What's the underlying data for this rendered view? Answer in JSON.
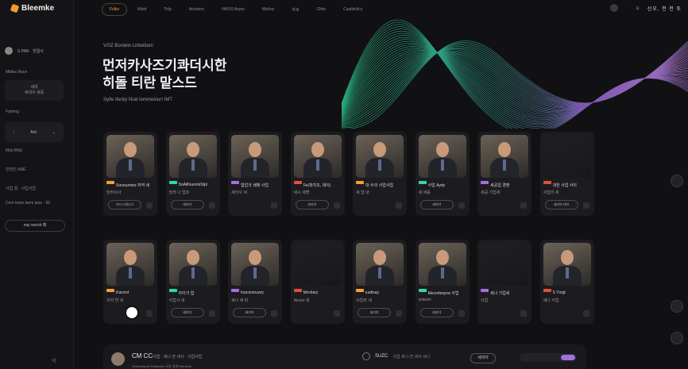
{
  "sidebar": {
    "logo": "Bleemke",
    "user": "S PAR · 연결사",
    "section1": "Mititas Bace",
    "card_line1": "세대",
    "card_line2": "세대사 세중",
    "section2": "Fairring",
    "select_left": "↑",
    "select_mid": "Ant",
    "select_right": "⌄",
    "item1": "Mob BNd",
    "item2": "안양인 ANE",
    "item3": "사업 월 · 사업사업",
    "item4": "Cent team lanm jane · 60",
    "pill": "nay wersb 패",
    "foot": "약"
  },
  "nav": {
    "tabs": [
      "Folks",
      "Weid",
      "Tirlp",
      "Aviokers",
      "VAIOS Aryes",
      "Mishss",
      "약세",
      "Clthe",
      "Castitictics"
    ],
    "active_index": 0
  },
  "topright": {
    "brand": "신오, 전 전 또",
    "items": [
      "·",
      "오"
    ]
  },
  "hero": {
    "kicker": "V/0Z Bordelo Lirbeiboni",
    "title_line1": "먼저카사즈기콰더시한",
    "title_line2": "히돌 티란 맡스드",
    "sub": "Sylfe Iferirp Nrat Iommeinur! IMT"
  },
  "row1": [
    {
      "name": "Soneumeto 저작 세",
      "role": "당라사사",
      "btn": "카드시세니사",
      "photo": true
    },
    {
      "name": "SoAlifouonisStpl",
      "role": "당라 나 업조",
      "btn": "세리야",
      "photo": true
    },
    {
      "name": "혐압크 쇄메 사업",
      "role": "세리사 세",
      "btn": "",
      "photo": true
    },
    {
      "name": "Fe(파치조, 데이)",
      "role": "세시 세명",
      "btn": "세리야",
      "photo": true
    },
    {
      "name": "대 수의 사업사업",
      "role": "세 업 내",
      "btn": "",
      "photo": true
    },
    {
      "name": "사업 Aydy",
      "role": "세 세를",
      "btn": "세리야",
      "photo": true
    },
    {
      "name": "세공업 경쟁",
      "role": "세공 기업세",
      "btn": "",
      "photo": true
    },
    {
      "name": "대한 사업 사이",
      "role": "사업리 세",
      "btn": "세리야 데이",
      "photo": false
    }
  ],
  "row2": [
    {
      "name": "Karorst",
      "role": "우리 연 세",
      "btn": "",
      "photo": true
    },
    {
      "name": "아이기 업",
      "role": "사업사 세",
      "btn": "세리야",
      "photo": true
    },
    {
      "name": "Inaconsruary",
      "role": "세나 세 피",
      "btn": "세리야",
      "photo": true
    },
    {
      "name": "Mocitary",
      "role": "Alcsor 세",
      "btn": "",
      "photo": false
    },
    {
      "name": "iuafisay",
      "role": "사업자 세",
      "btn": "세리야",
      "photo": true
    },
    {
      "name": "Mecerlesyne 사업",
      "role": "esleom",
      "btn": "세리야",
      "photo": true
    },
    {
      "name": "세나 기업세",
      "role": "사업",
      "btn": "",
      "photo": false
    },
    {
      "name": "S Ysrgt",
      "role": "세나 사업",
      "btn": "",
      "photo": true
    }
  ],
  "bottom": {
    "name": "CM CC",
    "role": "사업 · 세니 전 세사 · 사업사업",
    "desc": "Senhwaleurt Tefaarahn 사업 세세 Seedtum",
    "mid_label": "SUZC",
    "mid_sub": "사업 세니 전 세사 세니",
    "btn": "세리야"
  },
  "colors": {
    "accent": "#f2a035",
    "purple": "#a26fe0",
    "teal": "#2ddc9a"
  }
}
